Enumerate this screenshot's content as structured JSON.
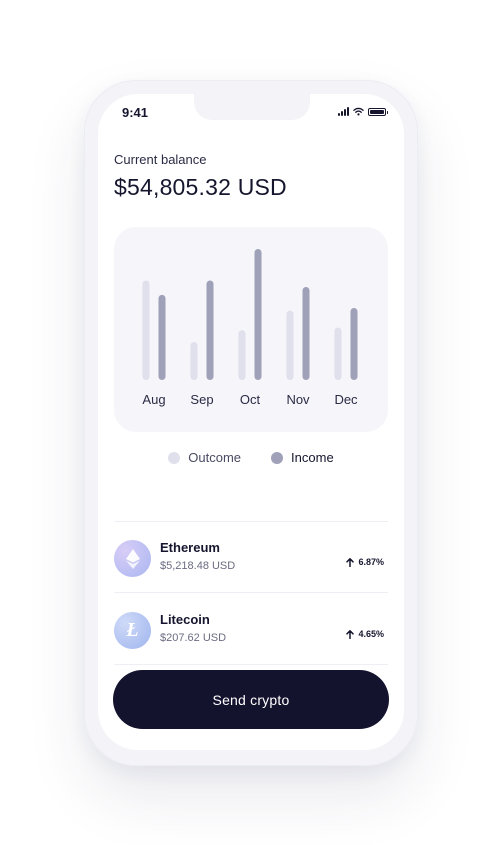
{
  "status_bar": {
    "time": "9:41"
  },
  "balance": {
    "label": "Current balance",
    "value": "$54,805.32 USD"
  },
  "chart_data": {
    "type": "bar",
    "categories": [
      "Aug",
      "Sep",
      "Oct",
      "Nov",
      "Dec"
    ],
    "series": [
      {
        "name": "Outcome",
        "values": [
          0.76,
          0.29,
          0.38,
          0.53,
          0.4
        ],
        "color": "#e0e0ec"
      },
      {
        "name": "Income",
        "values": [
          0.65,
          0.76,
          1.0,
          0.71,
          0.55
        ],
        "color": "#9fa1b9"
      }
    ],
    "ylim": [
      0,
      1
    ],
    "legend_position": "bottom-center"
  },
  "legend": {
    "outcome": "Outcome",
    "income": "Income"
  },
  "coins": [
    {
      "name": "Ethereum",
      "value": "$5,218.48 USD",
      "change": "6.87%",
      "icon": "ethereum-icon",
      "color_start": "#c8b8f2",
      "color_end": "#a9b6f0"
    },
    {
      "name": "Litecoin",
      "value": "$207.62 USD",
      "change": "4.65%",
      "icon": "litecoin-icon",
      "color_start": "#b9c9f5",
      "color_end": "#9fb5ee"
    }
  ],
  "send_button": {
    "label": "Send crypto"
  },
  "colors": {
    "primary": "#14132e",
    "outcome": "#e0e0ec",
    "income": "#9fa1b9"
  }
}
